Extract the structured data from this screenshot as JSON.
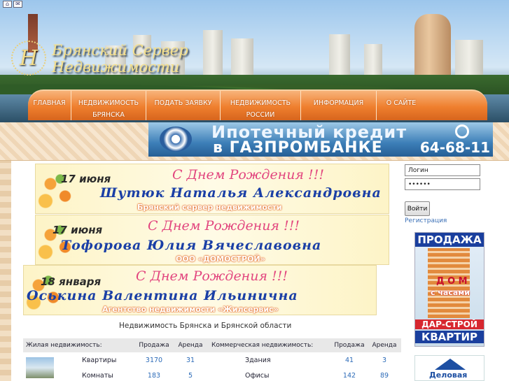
{
  "site": {
    "title_line1": "Брянский Сервер",
    "title_line2": "Недвижимости",
    "emblem_letter": "Н"
  },
  "top_icons": [
    "home-icon",
    "mail-icon"
  ],
  "nav": [
    {
      "line1": "ГЛАВНАЯ",
      "line2": ""
    },
    {
      "line1": "НЕДВИЖИМОСТЬ",
      "line2": "БРЯНСКА"
    },
    {
      "line1": "ПОДАТЬ ЗАЯВКУ",
      "line2": ""
    },
    {
      "line1": "НЕДВИЖИМОСТЬ",
      "line2": "РОССИИ"
    },
    {
      "line1": "ИНФОРМАЦИЯ",
      "line2": ""
    },
    {
      "line1": "О САЙТЕ",
      "line2": ""
    }
  ],
  "banner": {
    "line1": "Ипотечный кредит",
    "line2": "в ГАЗПРОМБАНКЕ",
    "phone": "64-68-11"
  },
  "birthdays": [
    {
      "date": "17 июня",
      "greeting": "С Днем Рождения !!!",
      "name": "Шутюк Наталья Александровна",
      "org": "Брянский сервер недвижимости"
    },
    {
      "date": "17 июня",
      "greeting": "С Днем Рождения !!!",
      "name": "Тофорова Юлия Вячеславовна",
      "org": "ООО «ДОМОСТРОЙ»"
    },
    {
      "date": "18 января",
      "greeting": "С Днем Рождения !!!",
      "name": "Оськина Валентина Ильинична",
      "org": "Агентство недвижимости «Жилсервис»"
    }
  ],
  "section_title": "Недвижимость Брянска и Брянской области",
  "table": {
    "headers": [
      "Жилая недвижимость:",
      "Продажа",
      "Аренда",
      "Коммерческая недвижимость:",
      "Продажа",
      "Аренда"
    ],
    "rows": [
      {
        "res_name": "Квартиры",
        "res_sale": "3170",
        "res_rent": "31",
        "com_name": "Здания",
        "com_sale": "41",
        "com_rent": "3"
      },
      {
        "res_name": "Комнаты",
        "res_sale": "183",
        "res_rent": "5",
        "com_name": "Офисы",
        "com_sale": "142",
        "com_rent": "89"
      }
    ]
  },
  "login": {
    "login_value": "Логин",
    "password_value": "••••••",
    "submit_label": "Войти",
    "register_label": "Регистрация"
  },
  "ad_sale": {
    "top": "ПРОДАЖА",
    "line1": "Д О М",
    "line2": "с часами",
    "line3": "ДАР-СТРОЙ",
    "line4": "КВАРТИР"
  },
  "ad_business": {
    "label": "Деловая"
  }
}
